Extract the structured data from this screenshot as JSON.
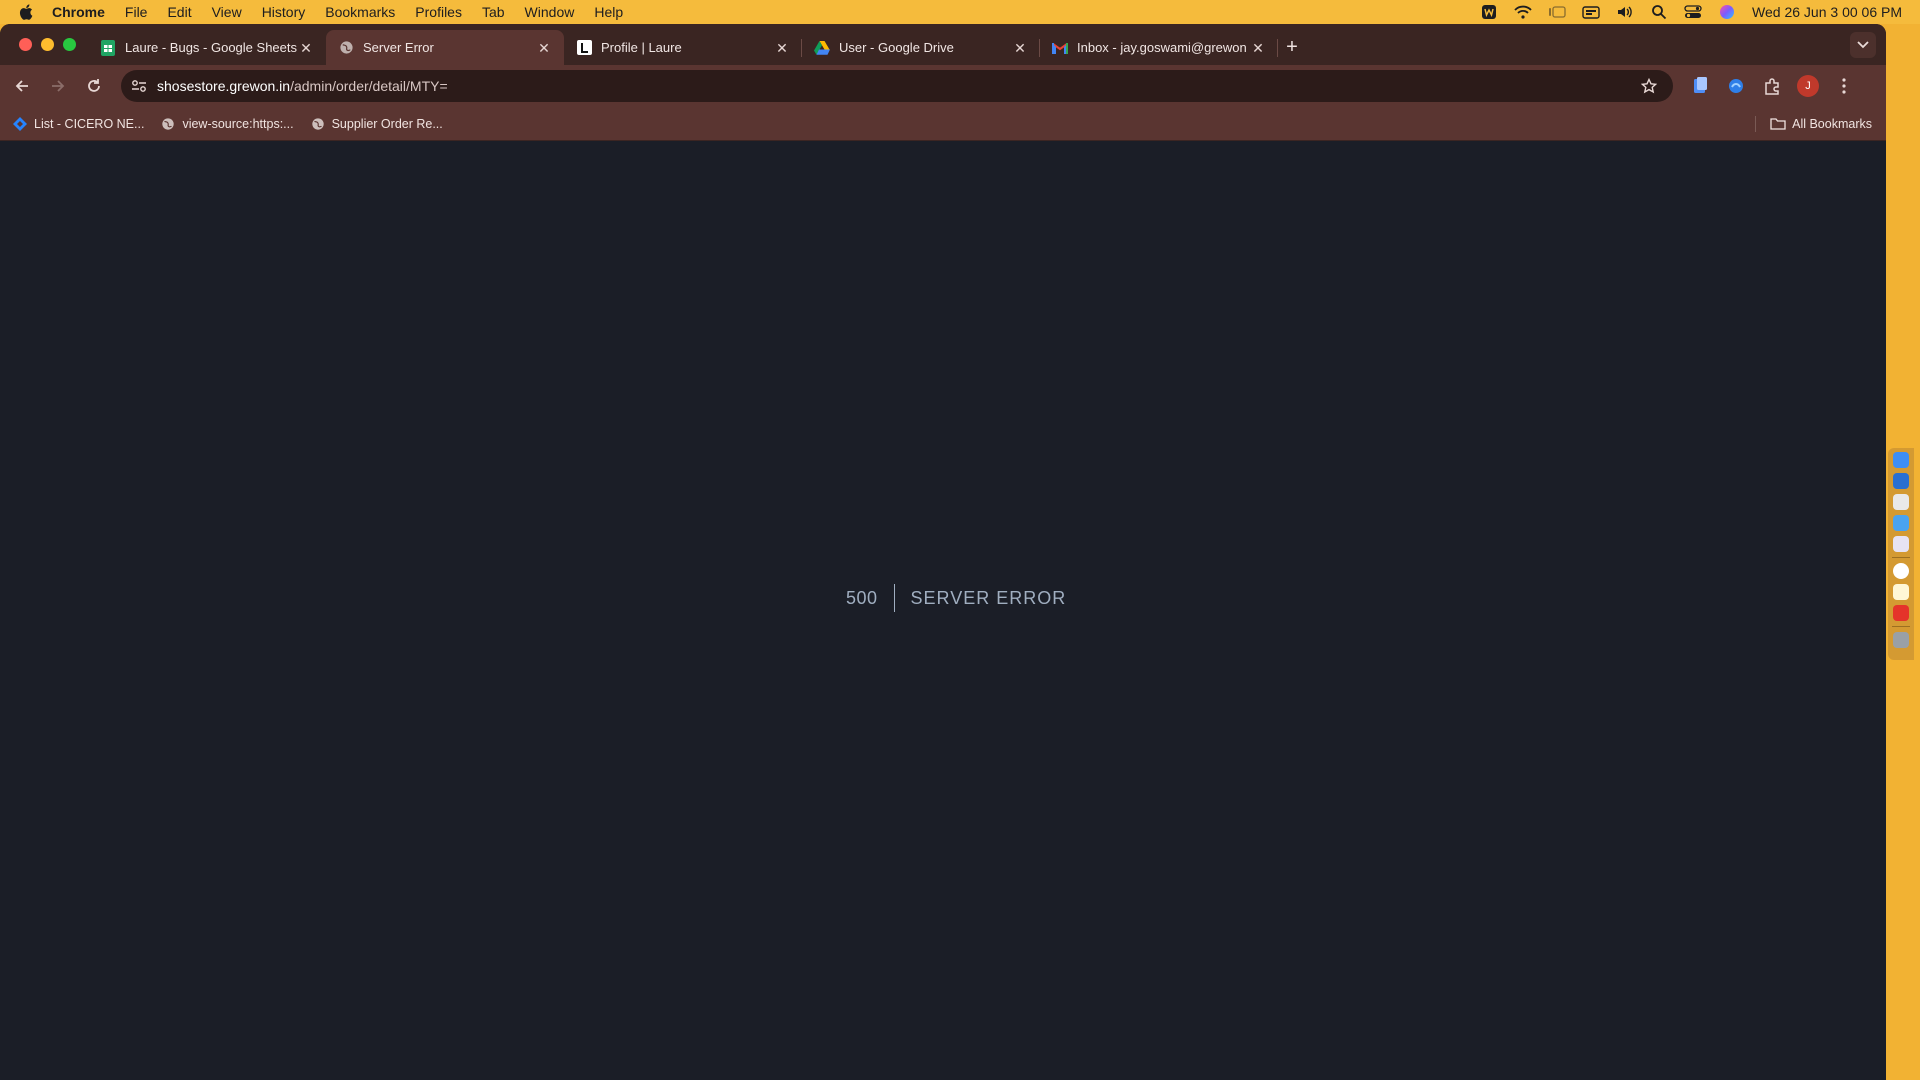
{
  "menubar": {
    "app_name": "Chrome",
    "items": [
      "File",
      "Edit",
      "View",
      "History",
      "Bookmarks",
      "Profiles",
      "Tab",
      "Window",
      "Help"
    ],
    "clock": "Wed 26 Jun  3 00 06 PM"
  },
  "tabs": [
    {
      "title": "Laure - Bugs - Google Sheets",
      "favicon": "sheets-icon",
      "active": false
    },
    {
      "title": "Server Error",
      "favicon": "globe-icon",
      "active": true
    },
    {
      "title": "Profile | Laure",
      "favicon": "laure-icon",
      "active": false
    },
    {
      "title": "User - Google Drive",
      "favicon": "drive-icon",
      "active": false
    },
    {
      "title": "Inbox - jay.goswami@grewon",
      "favicon": "gmail-icon",
      "active": false
    }
  ],
  "omnibox": {
    "url_host": "shosestore.grewon.in",
    "url_path": "/admin/order/detail/MTY="
  },
  "profile": {
    "initial": "J"
  },
  "bookmarks": [
    {
      "label": "List - CICERO NE...",
      "icon": "jira-icon"
    },
    {
      "label": "view-source:https:...",
      "icon": "globe-icon"
    },
    {
      "label": "Supplier Order Re...",
      "icon": "globe-icon"
    }
  ],
  "all_bookmarks_label": "All Bookmarks",
  "error": {
    "code": "500",
    "message": "Server Error"
  },
  "colors": {
    "menubar": "#f5bb3c",
    "tabstrip": "#3a2522",
    "toolbar": "#5a3531",
    "page_background": "#1b1e27",
    "error_text": "#a0aec0"
  }
}
